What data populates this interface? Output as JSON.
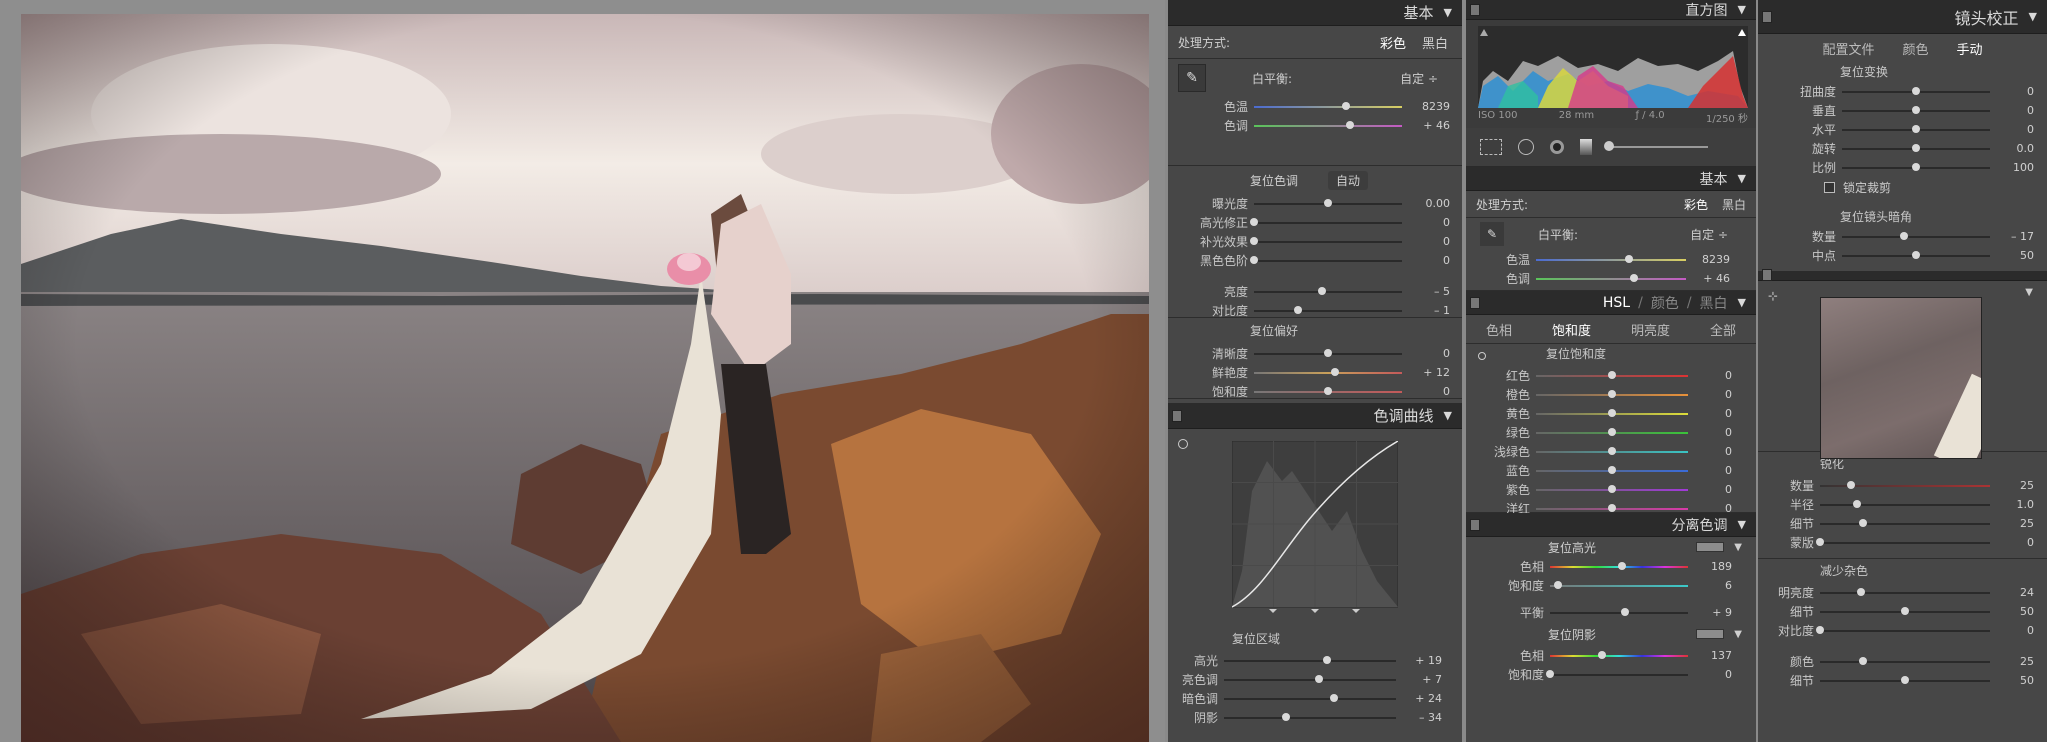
{
  "colors": {
    "panel_bg": "#474747",
    "header_bg": "#2b2b2b",
    "accent": "#ffffff"
  },
  "basic": {
    "title": "基本",
    "treatment_label": "处理方式:",
    "color_opt": "彩色",
    "bw_opt": "黑白",
    "wb_label": "白平衡:",
    "wb_value": "自定 ÷",
    "temp": {
      "label": "色温",
      "value": "8239",
      "level": 0.62
    },
    "tint": {
      "label": "色调",
      "value": "+ 46",
      "level": 0.65
    },
    "reset_tone": "复位色调",
    "auto": "自动",
    "exposure": {
      "label": "曝光度",
      "value": "0.00",
      "level": 0.5
    },
    "highlight_recovery": {
      "label": "高光修正",
      "value": "0",
      "level": 0.0
    },
    "fill_light": {
      "label": "补光效果",
      "value": "0",
      "level": 0.0
    },
    "blacks": {
      "label": "黑色色阶",
      "value": "0",
      "level": 0.0
    },
    "brightness": {
      "label": "亮度",
      "value": "– 5",
      "level": 0.46
    },
    "contrast": {
      "label": "对比度",
      "value": "– 1",
      "level": 0.3
    },
    "reset_presence": "复位偏好",
    "clarity": {
      "label": "清晰度",
      "value": "0",
      "level": 0.5
    },
    "vibrance": {
      "label": "鲜艳度",
      "value": "+ 12",
      "level": 0.55
    },
    "saturation": {
      "label": "饱和度",
      "value": "0",
      "level": 0.5
    }
  },
  "tone_curve": {
    "title": "色调曲线",
    "reset_region": "复位区域",
    "highlights": {
      "label": "高光",
      "value": "+ 19",
      "level": 0.6
    },
    "lights": {
      "label": "亮色调",
      "value": "+ 7",
      "level": 0.55
    },
    "darks": {
      "label": "暗色调",
      "value": "+ 24",
      "level": 0.64
    },
    "shadows": {
      "label": "阴影",
      "value": "– 34",
      "level": 0.36
    }
  },
  "histogram": {
    "title": "直方图",
    "iso": "ISO 100",
    "focal": "28 mm",
    "aperture": "ƒ / 4.0",
    "shutter": "1/250 秒"
  },
  "basic2": {
    "title": "基本",
    "treatment_label": "处理方式:",
    "color_opt": "彩色",
    "bw_opt": "黑白",
    "wb_label": "白平衡:",
    "wb_value": "自定 ÷",
    "temp": {
      "label": "色温",
      "value": "8239",
      "level": 0.62
    },
    "tint": {
      "label": "色调",
      "value": "+ 46",
      "level": 0.65
    }
  },
  "hsl": {
    "tab_hsl": "HSL",
    "sep": "/",
    "tab_color": "颜色",
    "tab_bw": "黑白",
    "sub_hue": "色相",
    "sub_saturation": "饱和度",
    "sub_luminance": "明亮度",
    "sub_all": "全部",
    "reset": "复位饱和度",
    "rows": [
      {
        "label": "红色",
        "value": "0"
      },
      {
        "label": "橙色",
        "value": "0"
      },
      {
        "label": "黄色",
        "value": "0"
      },
      {
        "label": "绿色",
        "value": "0"
      },
      {
        "label": "浅绿色",
        "value": "0"
      },
      {
        "label": "蓝色",
        "value": "0"
      },
      {
        "label": "紫色",
        "value": "0"
      },
      {
        "label": "洋红",
        "value": "0"
      }
    ]
  },
  "split_toning": {
    "title": "分离色调",
    "reset_highlights": "复位高光",
    "hl_hue": {
      "label": "色相",
      "value": "189",
      "level": 0.52
    },
    "hl_sat": {
      "label": "饱和度",
      "value": "6",
      "level": 0.06
    },
    "balance": {
      "label": "平衡",
      "value": "+ 9",
      "level": 0.54
    },
    "reset_shadows": "复位阴影",
    "sh_hue": {
      "label": "色相",
      "value": "137",
      "level": 0.38
    },
    "sh_sat": {
      "label": "饱和度",
      "value": "0",
      "level": 0.0
    }
  },
  "lens": {
    "title": "镜头校正",
    "tab_profile": "配置文件",
    "tab_color": "颜色",
    "tab_manual": "手动",
    "reset_transform": "复位变换",
    "distortion": {
      "label": "扭曲度",
      "value": "0",
      "level": 0.5
    },
    "vertical": {
      "label": "垂直",
      "value": "0",
      "level": 0.5
    },
    "horizontal": {
      "label": "水平",
      "value": "0",
      "level": 0.5
    },
    "rotate": {
      "label": "旋转",
      "value": "0.0",
      "level": 0.5
    },
    "scale": {
      "label": "比例",
      "value": "100",
      "level": 0.5
    },
    "constrain": "锁定裁剪",
    "reset_vignette": "复位镜头暗角",
    "amount": {
      "label": "数量",
      "value": "– 17",
      "level": 0.42
    },
    "midpoint": {
      "label": "中点",
      "value": "50",
      "level": 0.5
    }
  },
  "detail": {
    "sharpen_title": "锐化",
    "amount": {
      "label": "数量",
      "value": "25",
      "level": 0.18
    },
    "radius": {
      "label": "半径",
      "value": "1.0",
      "level": 0.22
    },
    "detail": {
      "label": "细节",
      "value": "25",
      "level": 0.25
    },
    "masking": {
      "label": "蒙版",
      "value": "0",
      "level": 0.0
    },
    "noise_title": "减少杂色",
    "luminance": {
      "label": "明亮度",
      "value": "24",
      "level": 0.24
    },
    "lum_detail": {
      "label": "细节",
      "value": "50",
      "level": 0.5
    },
    "lum_contrast": {
      "label": "对比度",
      "value": "0",
      "level": 0.0
    },
    "color": {
      "label": "颜色",
      "value": "25",
      "level": 0.25
    },
    "color_detail": {
      "label": "细节",
      "value": "50",
      "level": 0.5
    }
  }
}
